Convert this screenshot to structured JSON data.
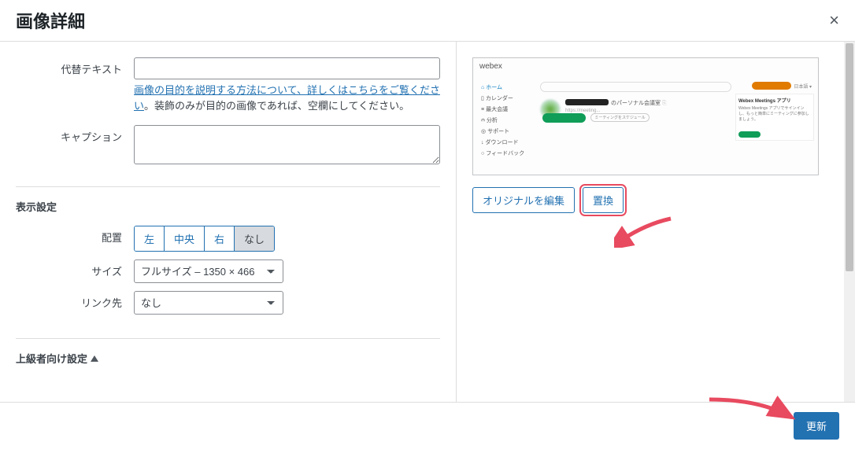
{
  "header": {
    "title": "画像詳細",
    "close_label": "×"
  },
  "form": {
    "alt_text": {
      "label": "代替テキスト",
      "value": "",
      "help_link_text": "画像の目的を説明する方法について、詳しくはこちらをご覧ください",
      "help_suffix": "。装飾のみが目的の画像であれば、空欄にしてください。"
    },
    "caption": {
      "label": "キャプション",
      "value": ""
    }
  },
  "display_settings": {
    "heading": "表示設定",
    "alignment": {
      "label": "配置",
      "options": [
        "左",
        "中央",
        "右",
        "なし"
      ],
      "selected": "なし"
    },
    "size": {
      "label": "サイズ",
      "selected": "フルサイズ – 1350 × 466"
    },
    "link_to": {
      "label": "リンク先",
      "selected": "なし"
    }
  },
  "advanced": {
    "label": "上級者向け設定"
  },
  "preview": {
    "brand": "webex",
    "sidebar_items": [
      "ホーム",
      "カレンダー",
      "最大会議",
      "分析",
      "サポート",
      "ダウンロード",
      "フィードバック"
    ],
    "room_text": "のパーソナル会議室",
    "schedule_text": "ミーティングをスケジュール",
    "right_title": "Webex Meetings アプリ"
  },
  "actions": {
    "edit_original": "オリジナルを編集",
    "replace": "置換"
  },
  "footer": {
    "update": "更新"
  }
}
